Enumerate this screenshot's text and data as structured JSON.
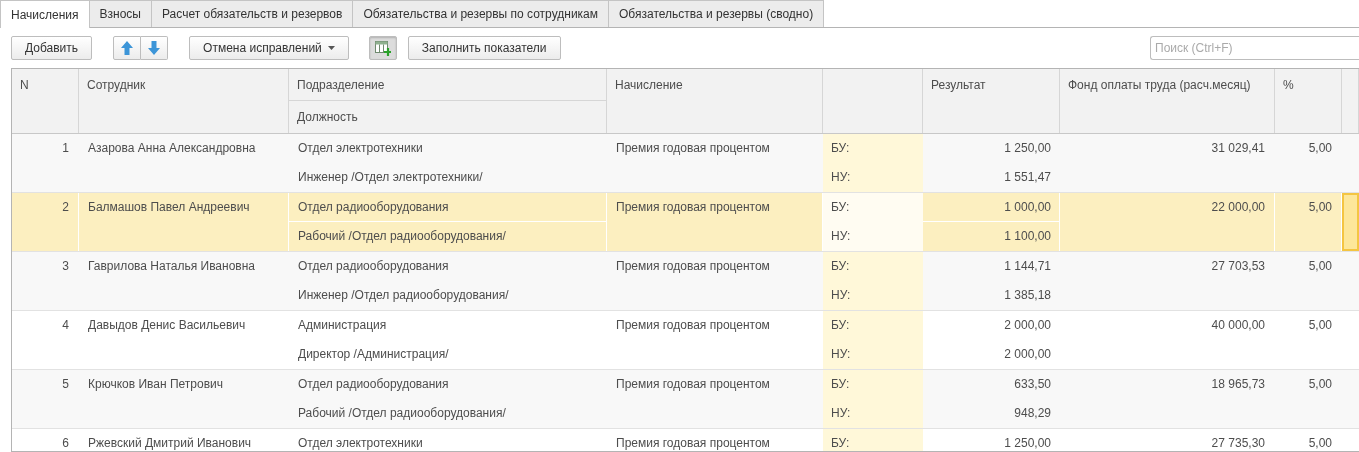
{
  "tabs": [
    {
      "label": "Начисления",
      "selected": true
    },
    {
      "label": "Взносы",
      "selected": false
    },
    {
      "label": "Расчет обязательств и резервов",
      "selected": false
    },
    {
      "label": "Обязательства и резервы по сотрудникам",
      "selected": false
    },
    {
      "label": "Обязательства и резервы (сводно)",
      "selected": false
    }
  ],
  "toolbar": {
    "add_button": "Добавить",
    "cancel_button": "Отмена исправлений",
    "grid_toggle": {
      "on": true
    },
    "fill_button": "Заполнить показатели",
    "search": {
      "placeholder": "Поиск (Ctrl+F)"
    }
  },
  "table": {
    "header": {
      "n": "N",
      "employee": "Сотрудник",
      "department": "Подразделение",
      "position": "Должность",
      "accrual": "Начисление",
      "result": "Результат",
      "fund": "Фонд оплаты труда (расч.месяц)",
      "percent": "%"
    },
    "rows": [
      {
        "n": "1",
        "employee": "Азарова Анна Александровна",
        "department": "Отдел электротехники",
        "position": "Инженер /Отдел электротехники/",
        "accrual": "Премия годовая процентом",
        "bu_label": "БУ:",
        "nu_label": "НУ:",
        "result_bu": "1 250,00",
        "result_nu": "1 551,47",
        "fund": "31 029,41",
        "percent": "5,00",
        "selected": false
      },
      {
        "n": "2",
        "employee": "Балмашов Павел Андреевич",
        "department": "Отдел радиооборудования",
        "position": "Рабочий /Отдел радиооборудования/",
        "accrual": "Премия годовая процентом",
        "bu_label": "БУ:",
        "nu_label": "НУ:",
        "result_bu": "1 000,00",
        "result_nu": "1 100,00",
        "fund": "22 000,00",
        "percent": "5,00",
        "selected": true
      },
      {
        "n": "3",
        "employee": "Гаврилова Наталья Ивановна",
        "department": "Отдел радиооборудования",
        "position": "Инженер /Отдел радиооборудования/",
        "accrual": "Премия годовая процентом",
        "bu_label": "БУ:",
        "nu_label": "НУ:",
        "result_bu": "1 144,71",
        "result_nu": "1 385,18",
        "fund": "27 703,53",
        "percent": "5,00",
        "selected": false
      },
      {
        "n": "4",
        "employee": "Давыдов Денис Васильевич",
        "department": "Администрация",
        "position": "Директор /Администрация/",
        "accrual": "Премия годовая процентом",
        "bu_label": "БУ:",
        "nu_label": "НУ:",
        "result_bu": "2 000,00",
        "result_nu": "2 000,00",
        "fund": "40 000,00",
        "percent": "5,00",
        "selected": false
      },
      {
        "n": "5",
        "employee": "Крючков Иван Петрович",
        "department": "Отдел радиооборудования",
        "position": "Рабочий /Отдел радиооборудования/",
        "accrual": "Премия годовая процентом",
        "bu_label": "БУ:",
        "nu_label": "НУ:",
        "result_bu": "633,50",
        "result_nu": "948,29",
        "fund": "18 965,73",
        "percent": "5,00",
        "selected": false
      },
      {
        "n": "6",
        "employee": "Ржевский Дмитрий Иванович",
        "department": "Отдел электротехники",
        "accrual": "Премия годовая процентом",
        "bu_label": "БУ:",
        "result_bu": "1 250,00",
        "fund": "27 735,30",
        "percent": "5,00",
        "selected": false
      }
    ]
  }
}
